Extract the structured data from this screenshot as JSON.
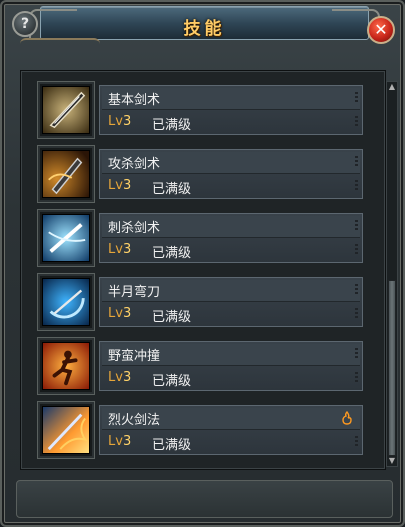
{
  "window": {
    "title": "技能"
  },
  "buttons": {
    "help_label": "?",
    "close_label": "✕"
  },
  "skills": [
    {
      "name": "基本剑术",
      "lv_prefix": "Lv",
      "level": "3",
      "status": "已满级",
      "icon": "sword-blade-icon",
      "color_a": "#c8b27a",
      "color_b": "#3a2c12"
    },
    {
      "name": "攻杀剑术",
      "lv_prefix": "Lv",
      "level": "3",
      "status": "已满级",
      "icon": "attack-sword-icon",
      "color_a": "#d08a2a",
      "color_b": "#2a1406"
    },
    {
      "name": "刺杀剑术",
      "lv_prefix": "Lv",
      "level": "3",
      "status": "已满级",
      "icon": "thrust-sword-icon",
      "color_a": "#9fe4ff",
      "color_b": "#0f3a66"
    },
    {
      "name": "半月弯刀",
      "lv_prefix": "Lv",
      "level": "3",
      "status": "已满级",
      "icon": "crescent-blade-icon",
      "color_a": "#3fb4ff",
      "color_b": "#08264a"
    },
    {
      "name": "野蛮冲撞",
      "lv_prefix": "Lv",
      "level": "3",
      "status": "已满级",
      "icon": "barbarian-charge-icon",
      "color_a": "#ffb040",
      "color_b": "#8a1a06"
    },
    {
      "name": "烈火剑法",
      "lv_prefix": "Lv",
      "level": "3",
      "status": "已满级",
      "icon": "flame-sword-icon",
      "color_a": "#ff9a30",
      "color_b": "#1a3a6a",
      "has_flame_badge": true
    }
  ]
}
